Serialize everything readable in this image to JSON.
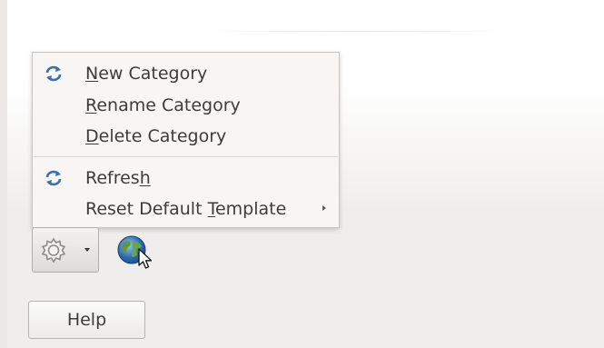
{
  "menu": {
    "items": [
      {
        "prefix": "",
        "mnemonic": "N",
        "suffix": "ew Category",
        "icon": "refresh-icon"
      },
      {
        "prefix": "",
        "mnemonic": "R",
        "suffix": "ename Category"
      },
      {
        "prefix": "",
        "mnemonic": "D",
        "suffix": "elete Category"
      },
      {
        "prefix": "Refres",
        "mnemonic": "h",
        "suffix": "",
        "icon": "refresh-icon"
      },
      {
        "prefix": "Reset Default ",
        "mnemonic": "T",
        "suffix": "emplate",
        "has_submenu": true
      }
    ]
  },
  "toolbar": {
    "gear_icon": "gear-icon",
    "dropdown_icon": "caret-down-icon",
    "globe_icon": "globe-icon"
  },
  "help_button": {
    "label": "Help"
  },
  "colors": {
    "background": "#efeeed",
    "menu_background": "#f7f6f5",
    "menu_border": "#c6c4c1",
    "text": "#3c3c3c",
    "icon_blue": "#3a6fb0"
  }
}
